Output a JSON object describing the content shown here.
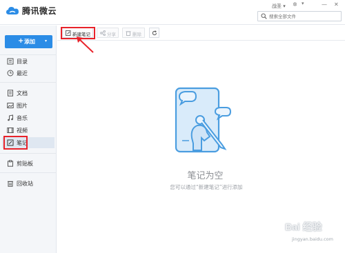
{
  "header": {
    "app_title": "腾讯微云",
    "user_name": "战圣 ▾",
    "settings_icon": "gear-icon",
    "minimize_icon": "minimize-icon",
    "close_icon": "close-icon",
    "search_placeholder": "搜索全部文件"
  },
  "sidebar": {
    "add_button": {
      "plus": "+",
      "label": "添加",
      "caret": "▾"
    },
    "items": [
      {
        "label": "目录",
        "icon": "catalog-icon"
      },
      {
        "label": "最近",
        "icon": "clock-icon"
      },
      {
        "label": "文档",
        "icon": "document-icon"
      },
      {
        "label": "图片",
        "icon": "image-icon"
      },
      {
        "label": "音乐",
        "icon": "music-icon"
      },
      {
        "label": "视频",
        "icon": "video-icon"
      },
      {
        "label": "笔记",
        "icon": "note-icon",
        "active": true
      },
      {
        "label": "剪贴板",
        "icon": "clipboard-icon"
      },
      {
        "label": "回收站",
        "icon": "trash-icon"
      }
    ]
  },
  "toolbar": {
    "new_note": "新建笔记",
    "share": "分享",
    "delete": "删除",
    "refresh_icon": "refresh-icon"
  },
  "empty_state": {
    "title": "笔记为空",
    "subtitle": "您可以通过“新建笔记”进行添加"
  },
  "watermark": {
    "brand": "Bai 经验",
    "url": "jingyan.baidu.com"
  },
  "colors": {
    "accent": "#2b8ce6",
    "highlight": "#e8222a",
    "sidebar_bg": "#f4f6f9"
  }
}
